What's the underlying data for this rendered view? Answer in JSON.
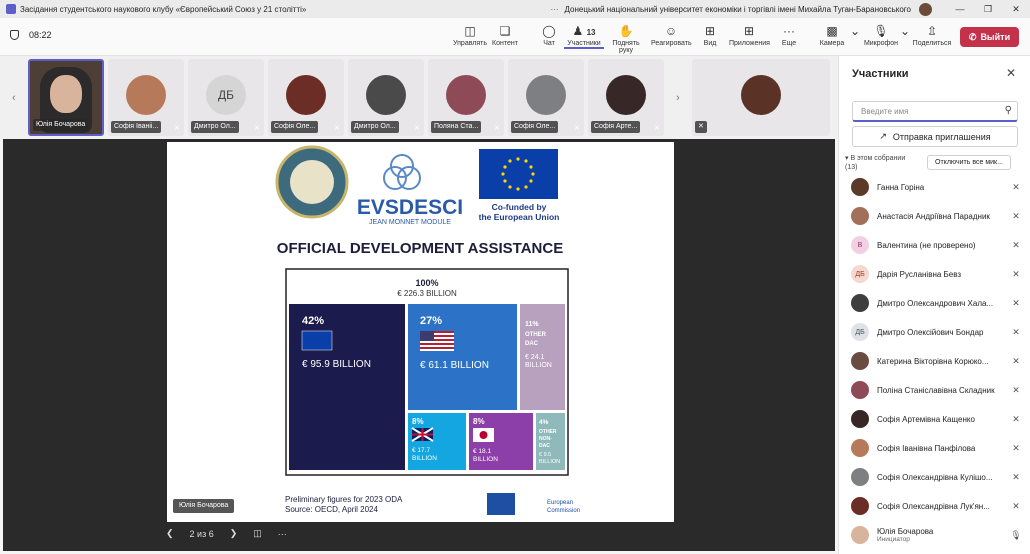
{
  "window": {
    "title": "Засідання студентського наукового клубу «Європейський Союз у 21 столітті»",
    "org": "Донецький національний університет економіки і торгівлі імені Михайла Туган-Барановського",
    "more": "···"
  },
  "meeting": {
    "timer": "08:22"
  },
  "toolbar": {
    "manage": "Управлять",
    "content": "Контент",
    "chat": "Чат",
    "participants": "Участники",
    "participants_count": "13",
    "raise_hand": "Поднять руку",
    "react": "Реагировать",
    "view": "Вид",
    "apps": "Приложения",
    "more": "Еще",
    "camera": "Камера",
    "mic": "Микрофон",
    "share": "Поделиться",
    "leave": "Выйти"
  },
  "tiles": [
    {
      "name": "Юлія Бочарова",
      "type": "camera"
    },
    {
      "name": "Софія Іваніі...",
      "color": "#b67a5b"
    },
    {
      "name": "Дмитро Ол...",
      "initials": "ДБ",
      "color": "#d5d5d5"
    },
    {
      "name": "Софія Оле...",
      "color": "#6b2d25"
    },
    {
      "name": "Дмитро Ол...",
      "color": "#4a4a4a"
    },
    {
      "name": "Поляна Ста...",
      "color": "#8e4a57"
    },
    {
      "name": "Софія Оле...",
      "color": "#7d7f83"
    },
    {
      "name": "Софія Арте...",
      "color": "#372827"
    },
    {
      "name": "",
      "color": "#5b3326"
    }
  ],
  "slide": {
    "evs": "EVSDESCI",
    "evs_sub": "JEAN MONNET MODULE",
    "cofunded": "Co-funded by the European Union",
    "heading": "OFFICIAL DEVELOPMENT ASSISTANCE",
    "total_pct": "100%",
    "total_val": "€ 226.3 BILLION",
    "blocks": [
      {
        "pct": "42%",
        "val": "€ 95.9 BILLION"
      },
      {
        "pct": "27%",
        "val": "€ 61.1 BILLION"
      },
      {
        "pct": "11%",
        "label": "OTHER DAC",
        "val": "€ 24.1 BILLION"
      },
      {
        "pct": "8%",
        "val": "€ 17.7 BILLION"
      },
      {
        "pct": "8%",
        "val": "€ 18.1 BILLION"
      },
      {
        "pct": "4%",
        "label": "OTHER NON-DAC",
        "val": "€ 9.5 BILLION"
      }
    ],
    "footer1": "Preliminary figures for 2023 ODA",
    "footer2": "Source: OECD, April 2024",
    "ec": "European Commission",
    "presenter": "Юлія Бочарова",
    "page": "2 из 6"
  },
  "panel": {
    "title": "Участники",
    "search_placeholder": "Введите имя",
    "invite": "Отправка приглашения",
    "in_meeting": "В этом собрании",
    "in_meeting_count": "(13)",
    "mute_all": "Отключить все мик...",
    "people": [
      {
        "name": "Ганна Горіна",
        "color": "#5b3a2a"
      },
      {
        "name": "Анастасія Андріївна Парадник",
        "color": "#a0705a"
      },
      {
        "name": "Валентина (не проверено)",
        "initials": "В",
        "color": "#f2d0e4",
        "fg": "#9b2d72"
      },
      {
        "name": "Дарія Русланівна Бевз",
        "initials": "ДБ",
        "color": "#f5d8cf",
        "fg": "#a53d23"
      },
      {
        "name": "Дмитро Олександрович Хала...",
        "color": "#3e3e3e"
      },
      {
        "name": "Дмитро Олексійович Бондар",
        "initials": "ДБ",
        "color": "#dfe3e8",
        "fg": "#4b5563"
      },
      {
        "name": "Катерина Вікторівна Корюко...",
        "color": "#6a4b40"
      },
      {
        "name": "Поліна Станіславівна Складник",
        "color": "#8e4a57"
      },
      {
        "name": "Софія Артемівна Кащенко",
        "color": "#372827"
      },
      {
        "name": "Софія Іванівна Панфілова",
        "color": "#b67a5b"
      },
      {
        "name": "Софія Олександрівна Кулішо...",
        "color": "#7d7f83"
      },
      {
        "name": "Софія Олександрівна Лук'ян...",
        "color": "#6b2d25"
      },
      {
        "name": "Юлія Бочарова",
        "role": "Инициатор",
        "color": "#d9b49c"
      }
    ]
  }
}
